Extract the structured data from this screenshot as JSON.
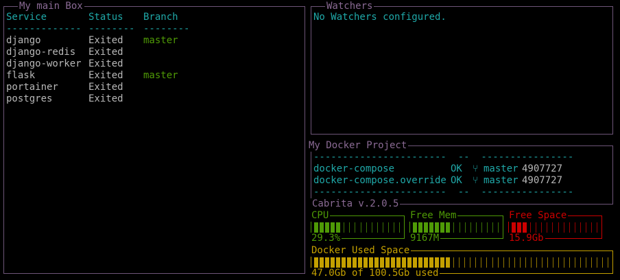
{
  "main_box": {
    "title": "My main Box",
    "headers": [
      "Service",
      "Status",
      "Branch"
    ],
    "separators": [
      "-------------",
      "--------",
      "--------"
    ],
    "rows": [
      {
        "service": "django",
        "status": "Exited",
        "branch": "master"
      },
      {
        "service": "django-redis",
        "status": "Exited",
        "branch": ""
      },
      {
        "service": "django-worker",
        "status": "Exited",
        "branch": ""
      },
      {
        "service": "flask",
        "status": "Exited",
        "branch": "master"
      },
      {
        "service": "portainer",
        "status": "Exited",
        "branch": ""
      },
      {
        "service": "postgres",
        "status": "Exited",
        "branch": ""
      }
    ]
  },
  "watchers": {
    "title": "Watchers",
    "message": "No Watchers configured."
  },
  "docker_project": {
    "title": "My Docker Project",
    "separator_top": "-----------------------  --  ----------------",
    "rows": [
      {
        "file": "docker-compose",
        "status": "OK",
        "icon": "⑂",
        "branch": "master",
        "commit": "4907727"
      },
      {
        "file": "docker-compose.override",
        "status": "OK",
        "icon": "⑂",
        "branch": "master",
        "commit": "4907727"
      }
    ],
    "separator_bottom": "-----------------------  --  ----------------",
    "footer": "Cabrita v.2.0.5"
  },
  "gauges": {
    "cpu": {
      "label": "CPU",
      "value_text": "29.3%",
      "fraction": 0.293,
      "color": "#4f9a06"
    },
    "mem": {
      "label": "Free Mem",
      "value_text": "9167M",
      "fraction": 0.42,
      "color": "#4f9a06"
    },
    "space": {
      "label": "Free Space",
      "value_text": "15.9Gb",
      "fraction": 0.158,
      "color": "#cc0000"
    },
    "docker": {
      "label": "Docker Used Space",
      "value_text": "47.0Gb of 100.5Gb used",
      "fraction": 0.468,
      "color": "#c4a000"
    }
  }
}
